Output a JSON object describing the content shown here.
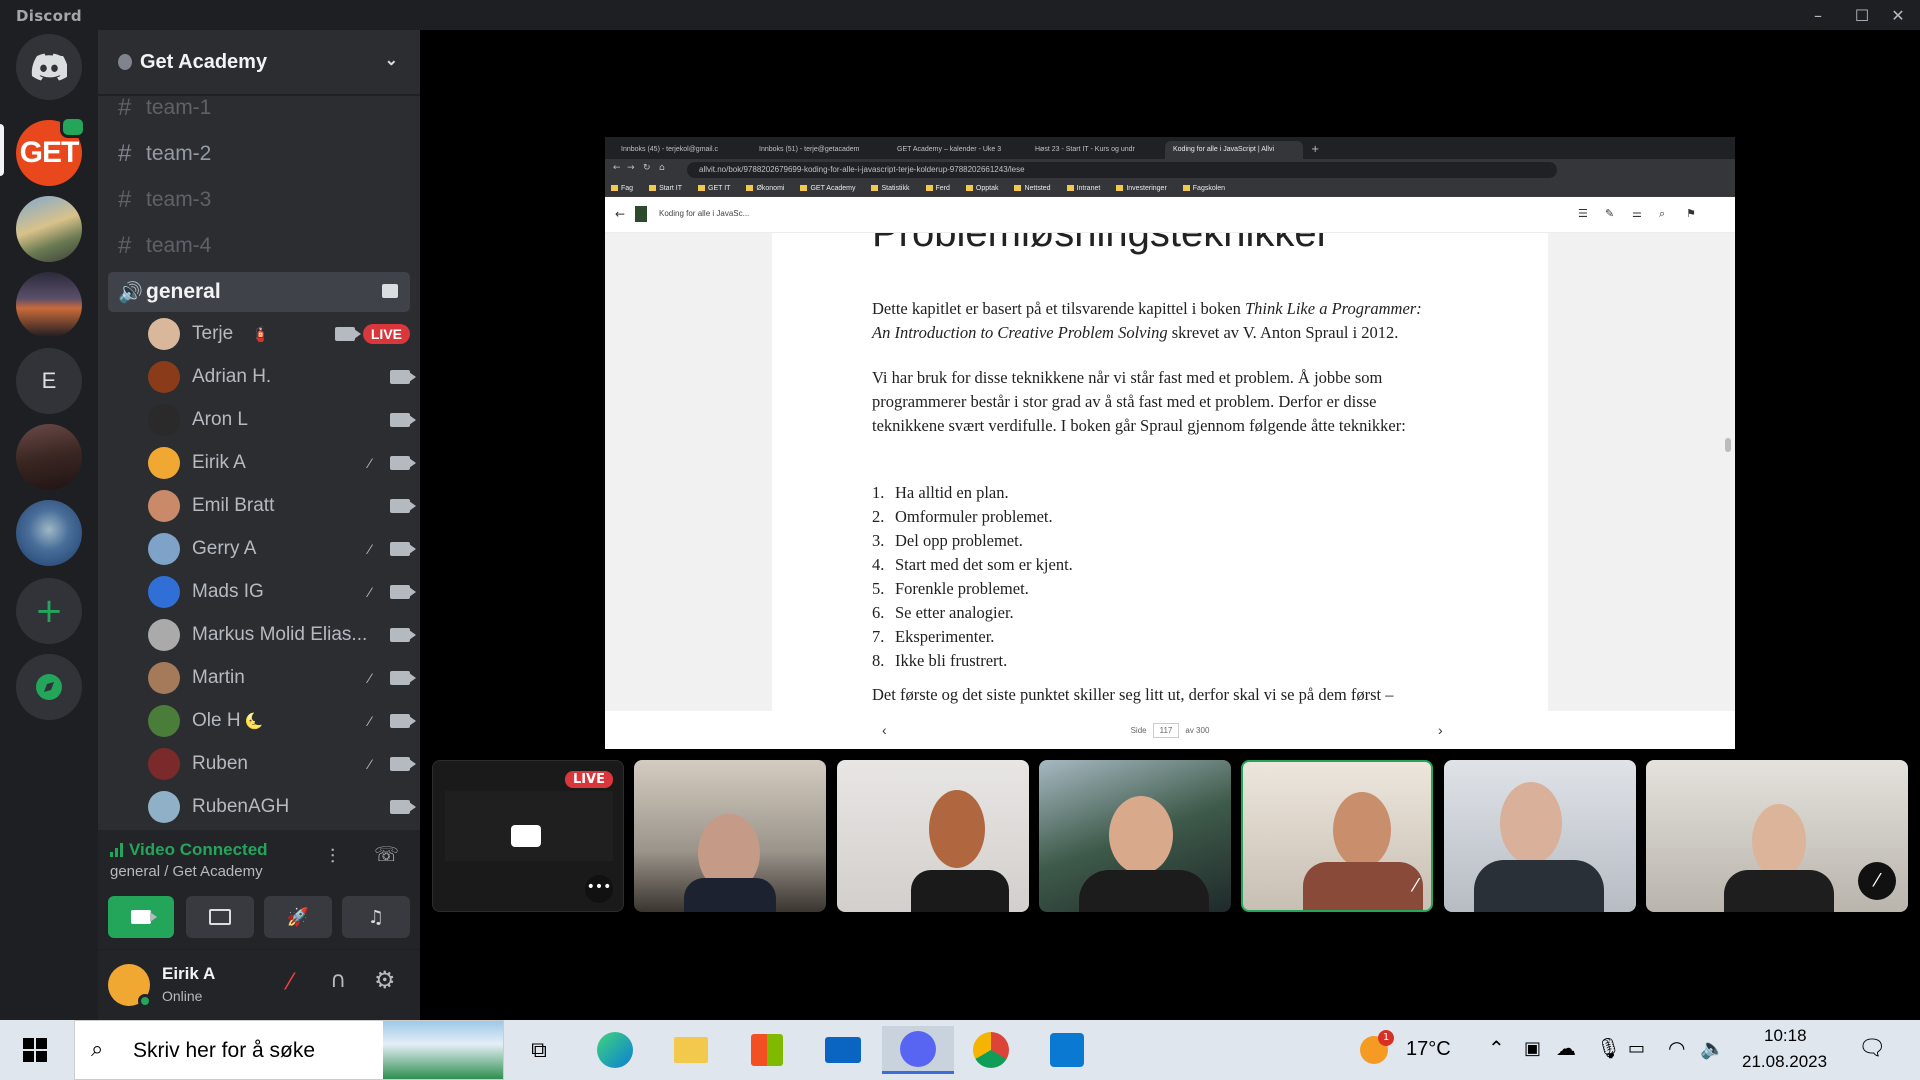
{
  "window": {
    "title": "Discord"
  },
  "guilds": [
    {
      "name": "Discord Home",
      "icon": "discord-logo-icon"
    },
    {
      "name": "Get Academy",
      "icon": "get-academy-icon"
    },
    {
      "name": "Server 3",
      "icon": "photo"
    },
    {
      "name": "Server 4",
      "icon": "photo"
    },
    {
      "name": "E",
      "letter": "E"
    },
    {
      "name": "Server 6",
      "icon": "photo"
    },
    {
      "name": "Server 7",
      "icon": "photo"
    },
    {
      "name": "Add a Server",
      "icon": "plus-icon"
    },
    {
      "name": "Explore",
      "icon": "compass-icon"
    }
  ],
  "server": {
    "name": "Get Academy"
  },
  "channels": [
    {
      "name": "team-1",
      "type": "text"
    },
    {
      "name": "team-2",
      "type": "text"
    },
    {
      "name": "team-3",
      "type": "text"
    },
    {
      "name": "team-4",
      "type": "text"
    },
    {
      "name": "general",
      "type": "voice"
    }
  ],
  "voice_members": [
    {
      "name": "Terje",
      "badge": "🧯",
      "camera": true,
      "live": "LIVE",
      "muted": false,
      "color": "#d9b79a"
    },
    {
      "name": "Adrian H.",
      "camera": true,
      "muted": false,
      "color": "#8a3b1a"
    },
    {
      "name": "Aron L",
      "camera": true,
      "muted": false,
      "color": "#2a2a2a"
    },
    {
      "name": "Eirik A",
      "camera": true,
      "muted": true,
      "color": "#f0a832"
    },
    {
      "name": "Emil Bratt",
      "camera": true,
      "muted": false,
      "color": "#c98a6a"
    },
    {
      "name": "Gerry A",
      "camera": true,
      "muted": true,
      "color": "#7fa2c9"
    },
    {
      "name": "Mads IG",
      "camera": true,
      "muted": true,
      "color": "#2f6fd6"
    },
    {
      "name": "Markus Molid Elias...",
      "camera": true,
      "muted": false,
      "color": "#aaaaaa"
    },
    {
      "name": "Martin",
      "camera": true,
      "muted": true,
      "color": "#a57a5a"
    },
    {
      "name": "Ole H",
      "badge": "🌜",
      "camera": true,
      "muted": true,
      "color": "#4b7d3a"
    },
    {
      "name": "Ruben",
      "camera": true,
      "muted": true,
      "color": "#7a2a2a"
    },
    {
      "name": "RubenAGH",
      "camera": true,
      "muted": false,
      "color": "#8fb0c6"
    }
  ],
  "voice_status": {
    "title": "Video Connected",
    "subtitle": "general / Get Academy"
  },
  "user": {
    "name": "Eirik A",
    "status": "Online"
  },
  "browser": {
    "tabs": [
      "Innboks (45) - terjekol@gmail.c",
      "Innboks (51) - terje@getacadem",
      "GET Academy – kalender - Uke 3",
      "Høst 23 - Start IT - Kurs og undr",
      "Koding for alle i JavaScript | Allvi"
    ],
    "url": "allvit.no/bok/9788202679699-koding-for-alle-i-javascript-terje-kolderup-9788202661243/lese",
    "bookmarks": [
      "Fag",
      "Start IT",
      "GET IT",
      "Økonomi",
      "GET Academy",
      "Statistikk",
      "Ferd",
      "Opptak",
      "Nettsted",
      "Intranet",
      "Investeringer",
      "Fagskolen"
    ],
    "reader_title": "Koding for alle i JavaSc...",
    "heading": "Problemløsningsteknikker",
    "para1_a": "Dette kapitlet er basert på et tilsvarende kapittel i boken ",
    "para1_b": "Think Like a Programmer: An Introduction to Creative Problem Solving",
    "para1_c": " skrevet av V. Anton Spraul i 2012.",
    "para2": "Vi har bruk for disse teknikkene når vi står fast med et problem. Å jobbe som programmerer består i stor grad av å stå fast med et problem. Derfor er disse teknikkene svært verdifulle. I boken går Spraul gjennom følgende åtte teknikker:",
    "list": [
      "Ha alltid en plan.",
      "Omformuler problemet.",
      "Del opp problemet.",
      "Start med det som er kjent.",
      "Forenkle problemet.",
      "Se etter analogier.",
      "Eksperimenter.",
      "Ikke bli frustrert."
    ],
    "para3": "Det første og det siste punktet skiller seg litt ut, derfor skal vi se på dem først –",
    "page_label": "Side",
    "page_current": "117",
    "page_total": "av 300"
  },
  "video_tiles": [
    {
      "live": "LIVE",
      "bg": "#1a1a1a"
    },
    {
      "bg": "#8a8680"
    },
    {
      "bg": "#c9c4bf"
    },
    {
      "bg": "#5c6a55"
    },
    {
      "bg": "#b7aea3"
    },
    {
      "bg": "#c4c6c9"
    },
    {
      "bg": "#a6a39d"
    }
  ],
  "taskbar": {
    "search_placeholder": "Skriv her for å søke",
    "weather": "17°C",
    "time": "10:18",
    "date": "21.08.2023",
    "notif_count": "1"
  },
  "colors": {
    "accent": "#5865f2",
    "live": "#da373c",
    "connected": "#23a55a"
  }
}
